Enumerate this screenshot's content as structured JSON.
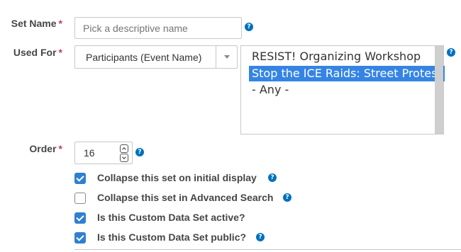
{
  "set_name": {
    "label": "Set Name",
    "required_mark": "*",
    "placeholder": "Pick a descriptive name",
    "help_icon": "question-circle-icon"
  },
  "used_for": {
    "label": "Used For",
    "required_mark": "*",
    "selected": "Participants (Event Name)",
    "dropdown_icon": "caret-down-icon",
    "options": [
      {
        "label": "RESIST! Organizing Workshop",
        "selected": false
      },
      {
        "label": "Stop the ICE Raids: Street Protest",
        "selected": true
      },
      {
        "label": "- Any -",
        "selected": false
      }
    ],
    "help_icon": "question-circle-icon"
  },
  "order": {
    "label": "Order",
    "required_mark": "*",
    "value": "16",
    "help_icon": "question-circle-icon"
  },
  "checkboxes": [
    {
      "label": "Collapse this set on initial display",
      "checked": true,
      "help": true
    },
    {
      "label": "Collapse this set in Advanced Search",
      "checked": false,
      "help": true
    },
    {
      "label": "Is this Custom Data Set active?",
      "checked": true,
      "help": false
    },
    {
      "label": "Is this Custom Data Set public?",
      "checked": true,
      "help": true
    }
  ],
  "colors": {
    "help": "#0071bd",
    "required": "#cf3458",
    "checkbox_on": "#2f80d0",
    "list_selection": "#3584e4"
  }
}
